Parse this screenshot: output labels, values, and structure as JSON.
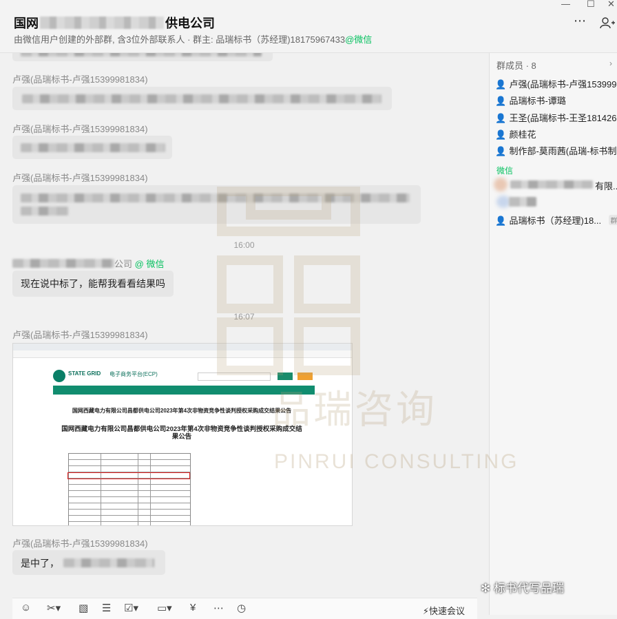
{
  "header": {
    "title_prefix": "国网",
    "title_suffix": "供电公司",
    "subtitle_main": "由微信用户创建的外部群, 含3位外部联系人 · 群主: 品瑞标书（苏经理)18175967433",
    "subtitle_wx": "@微信"
  },
  "window": {
    "minimize": "—",
    "maximize": "☐",
    "close": "✕"
  },
  "messages": {
    "sender_1": "卢强(品瑞标书-卢强15399981834)",
    "sender_2": "卢强(品瑞标书-卢强15399981834)",
    "sender_3": "卢强(品瑞标书-卢强15399981834)",
    "time_1": "16:00",
    "sender_4_suffix": "公司",
    "sender_4_wx": "@ 微信",
    "text_4": "现在说中标了，能帮我看看结果吗",
    "time_2": "16:07",
    "sender_5": "卢强(品瑞标书-卢强15399981834)",
    "sender_6": "卢强(品瑞标书-卢强15399981834)",
    "text_6": "是中了，"
  },
  "screenshot": {
    "portal_name": "电子商务平台(ECP)",
    "brand": "STATE GRID",
    "notice_title": "国网西藏电力有限公司昌都供电公司2023年第4次非物资竞争性谈判授权采购成交结果公告",
    "notice_title_2": "国网西藏电力有限公司昌都供电公司2023年第4次非物资竞争性谈判授权采购成交结果公告"
  },
  "sidebar": {
    "members_title": "群成员 · 8",
    "members": [
      {
        "name": "卢强(品瑞标书-卢强153999...",
        "icon": "user-blue-icon"
      },
      {
        "name": "品瑞标书-谭璐",
        "icon": "user-blue-icon"
      },
      {
        "name": "王圣(品瑞标书-王圣181426...",
        "icon": "user-blue-icon"
      },
      {
        "name": "颜桂花",
        "icon": "user-orange-icon"
      },
      {
        "name": "制作部-莫雨茜(品瑞-标书制...",
        "icon": "user-orange-icon"
      }
    ],
    "wx_label": "微信",
    "wx_member_1_suffix": "有限...",
    "owner_name": "品瑞标书（苏经理)18...",
    "owner_tag": "群主"
  },
  "input": {
    "quick_meeting": "快速会议"
  },
  "watermark": {
    "cn": "品瑞咨询",
    "en": "PINRUI CONSULTING"
  },
  "corner_caption": "标书代写品瑞",
  "colors": {
    "wechat_green": "#07c160",
    "state_grid_green": "#118d6f",
    "highlight_red": "#e02020"
  }
}
